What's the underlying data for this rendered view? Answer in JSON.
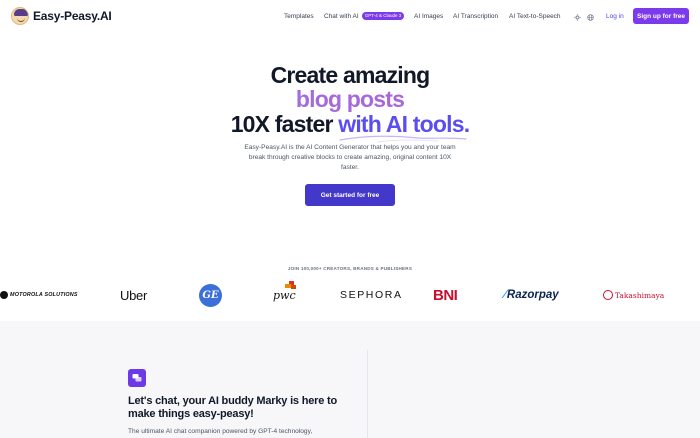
{
  "brand": {
    "name": "Easy-Peasy.AI"
  },
  "nav": {
    "items": [
      {
        "label": "Templates"
      },
      {
        "label": "Chat with AI",
        "badge": "GPT-4 & Claude 3"
      },
      {
        "label": "AI Images"
      },
      {
        "label": "AI Transcription"
      },
      {
        "label": "AI Text-to-Speech"
      }
    ],
    "login": "Log in",
    "signup": "Sign up for free"
  },
  "hero": {
    "line1": "Create amazing",
    "line2": "blog posts",
    "line3_plain": "10X faster ",
    "line3_accent": "with AI tools.",
    "description": "Easy-Peasy.AI is the AI Content Generator that helps you and your team break through creative blocks to create amazing, original content 10X faster.",
    "cta": "Get started for free"
  },
  "social_proof": {
    "heading": "JOIN 100,000+ CREATORS, BRANDS & PUBLISHERS",
    "logos": [
      "MOTOROLA SOLUTIONS",
      "Uber",
      "GE",
      "pwc",
      "SEPHORA",
      "BNI",
      "Razorpay",
      "Takashimaya"
    ]
  },
  "feature": {
    "title": "Let's chat, your AI buddy Marky is here to make things easy-peasy!",
    "description": "The ultimate AI chat companion powered by GPT-4 technology,"
  },
  "colors": {
    "primary": "#7c3aed",
    "cta": "#4338ca",
    "accent": "#5b4ef0"
  }
}
